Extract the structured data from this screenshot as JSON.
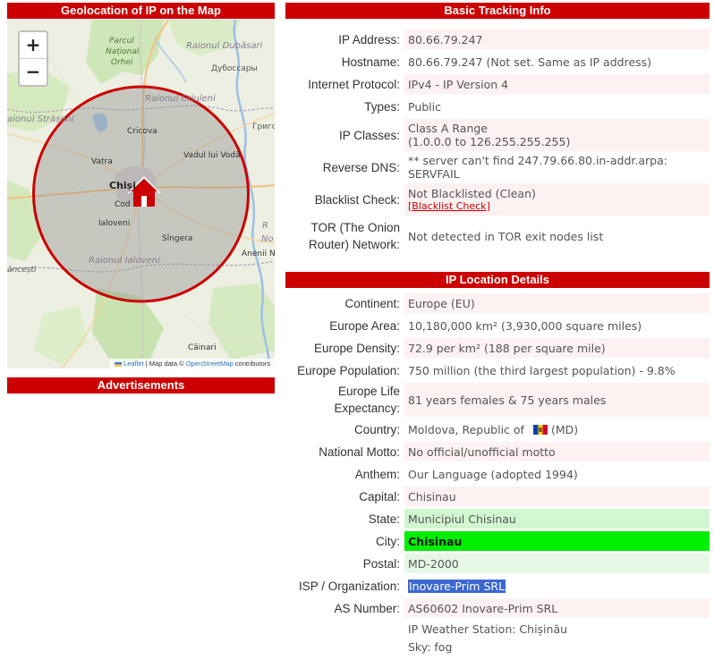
{
  "map_section": {
    "title": "Geolocation of IP on the Map",
    "zoom_in": "+",
    "zoom_out": "−",
    "marker_icon": "house-icon",
    "labels": {
      "parcul": "Parcul",
      "national": "Național",
      "orhei": "Orhei",
      "raionul_dubasari": "Raionul Dubăsari",
      "dubossary": "Дубоссары",
      "raionul_criuleni": "Raionul Criuleni",
      "raionul_straseni": "aionul Strășeni",
      "grigoriopol": "Григо",
      "cricova": "Cricova",
      "vatra": "Vatra",
      "vadul_lui_voda": "Vadul lui Vodă",
      "chisinau": "Chiși",
      "codru": "Cod",
      "ialoveni": "Ialoveni",
      "singera": "Sîngera",
      "raionul_ialoveni": "Raionul Ialoveni",
      "hancesti": "âncești",
      "anenii": "Anenii N",
      "raionul_r": "R",
      "no": "No",
      "cainari": "Căinari"
    },
    "attribution": {
      "leaflet": "Leaflet",
      "separator": " | Map data © ",
      "osm": "OpenStreetMap",
      "suffix": " contributors"
    },
    "colors": {
      "circle_stroke": "#cc0000",
      "marker": "#cc0000",
      "park": "#cde5b6"
    }
  },
  "ads": {
    "title": "Advertisements"
  },
  "basic": {
    "title": "Basic Tracking Info",
    "rows": [
      {
        "label": "IP Address:",
        "value": "80.66.79.247"
      },
      {
        "label": "Hostname:",
        "value": "80.66.79.247 (Not set. Same as IP address)"
      },
      {
        "label": "Internet Protocol:",
        "value": "IPv4 - IP Version 4"
      },
      {
        "label": "Types:",
        "value": "Public"
      },
      {
        "label": "IP Classes:",
        "value": "Class A Range",
        "value2": "(1.0.0.0 to 126.255.255.255)"
      },
      {
        "label": "Reverse DNS:",
        "value": "** server can't find 247.79.66.80.in-addr.arpa: SERVFAIL"
      },
      {
        "label": "Blacklist Check:",
        "value": "Not Blacklisted (Clean)",
        "link_open": "[",
        "link": "Blacklist Check",
        "link_close": "]"
      },
      {
        "label": "TOR (The Onion Router) Network:",
        "value": "Not detected in TOR exit nodes list"
      }
    ]
  },
  "location": {
    "title": "IP Location Details",
    "rows": [
      {
        "label": "Continent:",
        "value": "Europe (EU)"
      },
      {
        "label": "Europe Area:",
        "value": "10,180,000 km² (3,930,000 square miles)"
      },
      {
        "label": "Europe Density:",
        "value": "72.9 per km² (188 per square mile)"
      },
      {
        "label": "Europe Population:",
        "value": "750 million (the third largest population) - 9.8%"
      },
      {
        "label": "Europe Life Expectancy:",
        "value": "81 years females & 75 years males"
      },
      {
        "label": "Country:",
        "value": "Moldova, Republic of",
        "code": "(MD)"
      },
      {
        "label": "National Motto:",
        "value": "No official/unofficial motto"
      },
      {
        "label": "Anthem:",
        "value": "Our Language (adopted 1994)"
      },
      {
        "label": "Capital:",
        "value": "Chisinau"
      },
      {
        "label": "State:",
        "value": "Municipiul Chisinau"
      },
      {
        "label": "City:",
        "value": "Chisinau"
      },
      {
        "label": "Postal:",
        "value": "MD-2000"
      },
      {
        "label": "ISP / Organization:",
        "value": "Inovare-Prim SRL"
      },
      {
        "label": "AS Number:",
        "value": "AS60602 Inovare-Prim SRL"
      },
      {
        "label": "",
        "value": "IP Weather Station: Chișinău",
        "value2": "Sky: fog"
      }
    ]
  }
}
